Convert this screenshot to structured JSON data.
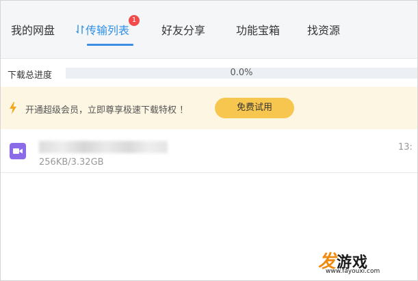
{
  "nav": {
    "items": [
      {
        "label": "我的网盘"
      },
      {
        "label": "传输列表",
        "icon": "sync-icon",
        "active": true,
        "badge": "1"
      },
      {
        "label": "好友分享"
      },
      {
        "label": "功能宝箱"
      },
      {
        "label": "找资源"
      }
    ]
  },
  "progress": {
    "label": "下载总进度",
    "percent_text": "0.0%",
    "fraction": 0.0
  },
  "banner": {
    "icon": "lightning-icon",
    "text": "开通超级会员，立即尊享极速下载特权 ！",
    "button_label": "免费试用"
  },
  "downloads": [
    {
      "icon": "video-file-icon",
      "size_text": "256KB/3.32GB",
      "time_text": "13:"
    }
  ],
  "watermark": {
    "logo_fa": "发",
    "logo_rest": "游戏",
    "url": "www.fayouxi.com"
  },
  "colors": {
    "accent": "#2f8fe6",
    "badge": "#f24b4b",
    "banner_bg": "#fdf6e3",
    "button_bg": "#f7c64f",
    "video_icon": "#8a6ce8"
  }
}
